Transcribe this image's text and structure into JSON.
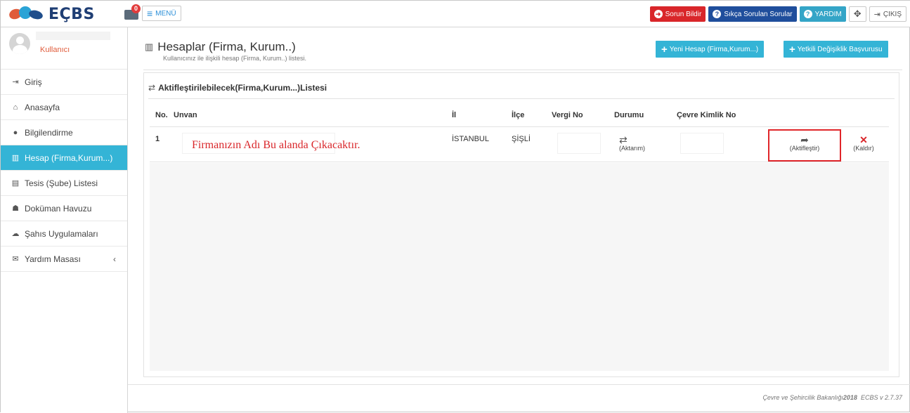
{
  "header": {
    "logo_text": "EÇBS",
    "mail_badge": "0",
    "menu_label": "MENÜ",
    "report_label": "Sorun Bildir",
    "faq_label": "Sıkça Sorulan Sorular",
    "help_label": "YARDIM",
    "logout_label": "ÇIKIŞ",
    "colors": {
      "red": "#d9262a",
      "navy": "#1f4e9c",
      "teal": "#34a5c7"
    }
  },
  "sidebar": {
    "user_name": "Kullanıcı",
    "items": [
      {
        "label": "Giriş",
        "icon": "sign-in-icon"
      },
      {
        "label": "Anasayfa",
        "icon": "home-icon"
      },
      {
        "label": "Bilgilendirme",
        "icon": "info-icon"
      },
      {
        "label": "Hesap (Firma,Kurum...)",
        "icon": "building-icon",
        "active": true
      },
      {
        "label": "Tesis (Şube) Listesi",
        "icon": "facility-icon"
      },
      {
        "label": "Doküman Havuzu",
        "icon": "people-icon"
      },
      {
        "label": "Şahıs Uygulamaları",
        "icon": "cloud-icon"
      },
      {
        "label": "Yardım Masası",
        "icon": "envelope-icon"
      }
    ]
  },
  "main": {
    "title": "Hesaplar (Firma, Kurum..)",
    "subtitle": "Kullanıcınız ile ilişkili hesap (Firma, Kurum..) listesi.",
    "new_account_label": "Yeni Hesap (Firma,Kurum...)",
    "authority_change_label": "Yetkili Değişiklik Başvurusu",
    "panel_title": "Aktifleştirilebilecek(Firma,Kurum...)Listesi",
    "columns": [
      "No.",
      "Unvan",
      "İl",
      "İlçe",
      "Vergi No",
      "Durumu",
      "Çevre Kimlik No"
    ],
    "rows": [
      {
        "no": "1",
        "unvan": "Firmanızın Adı Bu alanda Çıkacaktır.",
        "il": "İSTANBUL",
        "ilce": "ŞİŞLİ",
        "durum": "(Aktarım)",
        "activate_label": "(Aktifleştir)",
        "remove_label": "(Kaldır)"
      }
    ]
  },
  "footer": {
    "ministry": "Çevre ve Şehircilik Bakanlığı",
    "year": "2018",
    "version": "ECBS v 2.7.37"
  }
}
